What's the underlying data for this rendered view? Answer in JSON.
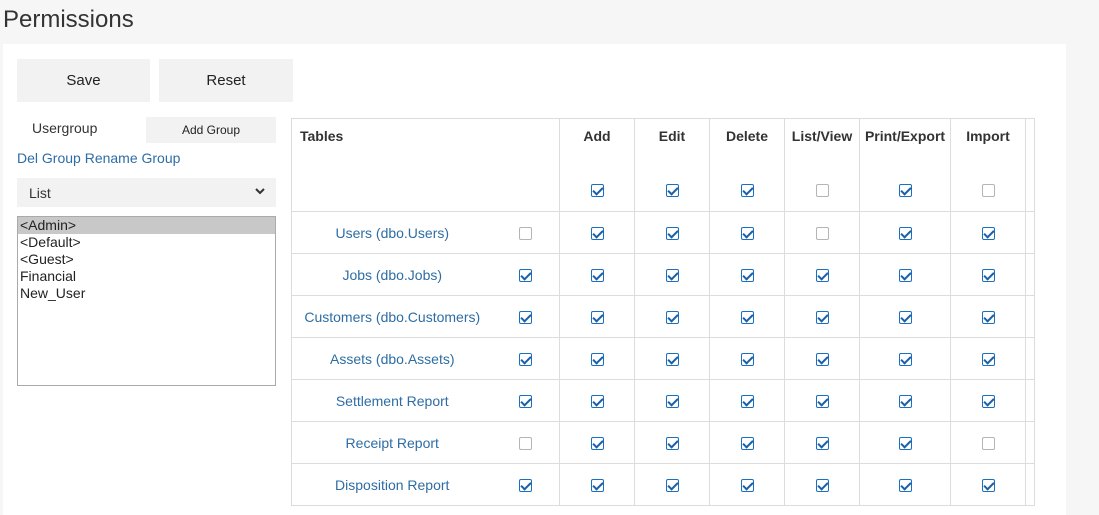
{
  "title": "Permissions",
  "buttons": {
    "save": "Save",
    "reset": "Reset",
    "add_group": "Add Group"
  },
  "usergroup_label": "Usergroup",
  "links": {
    "del_group": "Del Group",
    "rename_group": "Rename Group"
  },
  "select": {
    "value": "List"
  },
  "groups": [
    {
      "name": "<Admin>",
      "selected": true
    },
    {
      "name": "<Default>",
      "selected": false
    },
    {
      "name": "<Guest>",
      "selected": false
    },
    {
      "name": "Financial",
      "selected": false
    },
    {
      "name": "New_User",
      "selected": false
    }
  ],
  "table": {
    "columns": [
      "Tables",
      "Add",
      "Edit",
      "Delete",
      "List/View",
      "Print/Export",
      "Import"
    ],
    "header_checks": [
      true,
      true,
      true,
      false,
      true,
      false
    ],
    "rows": [
      {
        "name": "Users (dbo.Users)",
        "checks": [
          false,
          true,
          true,
          true,
          false,
          true,
          true
        ]
      },
      {
        "name": "Jobs (dbo.Jobs)",
        "checks": [
          true,
          true,
          true,
          true,
          true,
          true,
          true
        ]
      },
      {
        "name": "Customers (dbo.Customers)",
        "checks": [
          true,
          true,
          true,
          true,
          true,
          true,
          true
        ]
      },
      {
        "name": "Assets (dbo.Assets)",
        "checks": [
          true,
          true,
          true,
          true,
          true,
          true,
          true
        ]
      },
      {
        "name": "Settlement Report",
        "checks": [
          true,
          true,
          true,
          true,
          true,
          true,
          true
        ]
      },
      {
        "name": "Receipt Report",
        "checks": [
          false,
          true,
          true,
          true,
          true,
          true,
          false
        ]
      },
      {
        "name": "Disposition Report",
        "checks": [
          true,
          true,
          true,
          true,
          true,
          true,
          true
        ]
      }
    ]
  }
}
